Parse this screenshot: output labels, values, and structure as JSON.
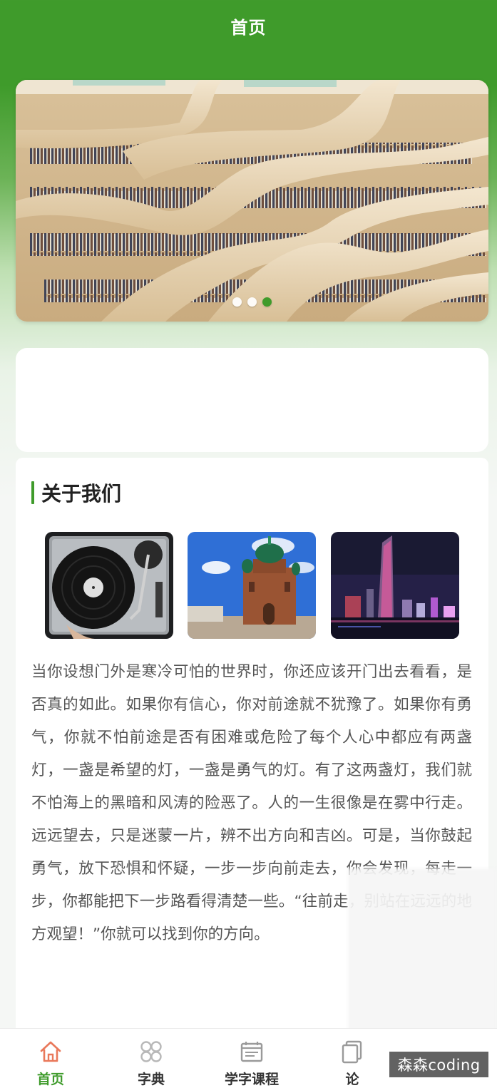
{
  "header": {
    "title": "首页"
  },
  "banner": {
    "slide_count": 3,
    "active_index": 2
  },
  "about": {
    "title": "关于我们",
    "photos": [
      "turntable-photo",
      "cathedral-photo",
      "city-night-photo"
    ],
    "text": "当你设想门外是寒冷可怕的世界时，你还应该开门出去看看，是否真的如此。如果你有信心，你对前途就不犹豫了。如果你有勇气，你就不怕前途是否有困难或危险了每个人心中都应有两盏灯，一盏是希望的灯，一盏是勇气的灯。有了这两盏灯，我们就不怕海上的黑暗和风涛的险恶了。人的一生很像是在雾中行走。远远望去，只是迷蒙一片，辨不出方向和吉凶。可是，当你鼓起勇气，放下恐惧和怀疑，一步一步向前走去，你会发现，每走一步，你都能把下一步路看得清楚一些。“往前走，别站在远远的地方观望！”你就可以找到你的方向。"
  },
  "tabbar": {
    "items": [
      {
        "label": "首页",
        "icon": "home-icon",
        "active": true
      },
      {
        "label": "字典",
        "icon": "dictionary-icon",
        "active": false
      },
      {
        "label": "学字课程",
        "icon": "course-icon",
        "active": false
      },
      {
        "label": "论",
        "icon": "forum-icon",
        "active": false
      }
    ]
  },
  "watermark": "森森coding",
  "colors": {
    "primary": "#3f9b2b",
    "text": "#555555",
    "title": "#222222"
  }
}
